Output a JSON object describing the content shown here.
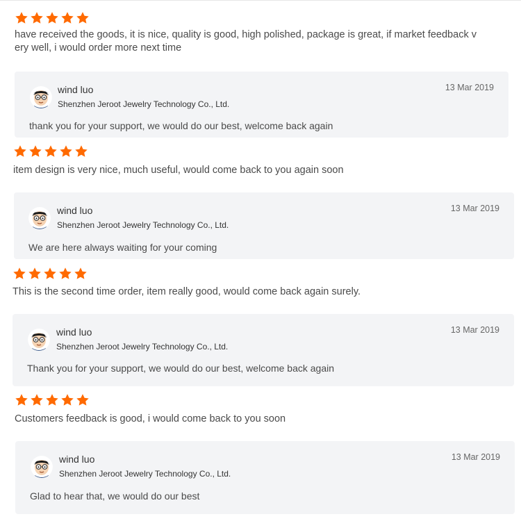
{
  "accent_color": "#ff6a00",
  "reviews": [
    {
      "rating": 5,
      "text": "have received the goods, it is nice, quality is good, high polished, package is great, if market feedback very well, i would order more next time",
      "reply": {
        "author": "wind luo",
        "company": "Shenzhen Jeroot Jewelry Technology Co., Ltd.",
        "date": "13 Mar 2019",
        "text": "thank you for your support, we would do our best, welcome back again"
      }
    },
    {
      "rating": 5,
      "text": "item design is very nice, much useful, would come back to you again soon",
      "reply": {
        "author": "wind luo",
        "company": "Shenzhen Jeroot Jewelry Technology Co., Ltd.",
        "date": "13 Mar 2019",
        "text": "We are here always waiting for your coming"
      }
    },
    {
      "rating": 5,
      "text": "This is the second time order, item really good, would come back again surely.",
      "reply": {
        "author": "wind luo",
        "company": "Shenzhen Jeroot Jewelry Technology Co., Ltd.",
        "date": "13 Mar 2019",
        "text": "Thank you for your support, we would do our best, welcome back again"
      }
    },
    {
      "rating": 5,
      "text": "Customers feedback is good, i would come back to you soon",
      "reply": {
        "author": "wind luo",
        "company": "Shenzhen Jeroot Jewelry Technology Co., Ltd.",
        "date": "13 Mar 2019",
        "text": "Glad to hear that, we would do our best"
      }
    }
  ]
}
